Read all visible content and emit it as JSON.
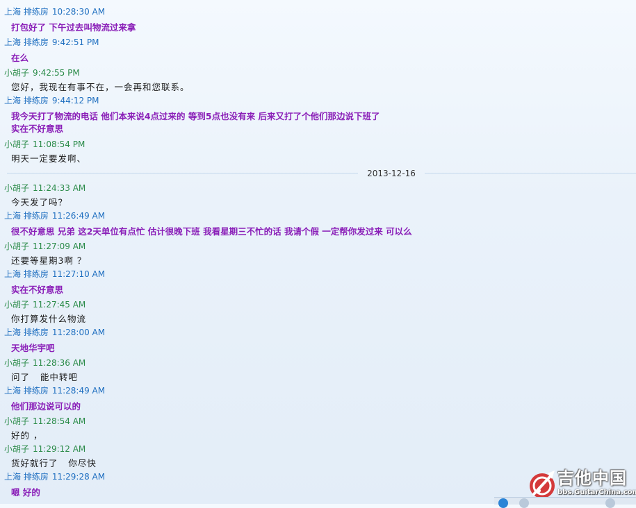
{
  "messages": [
    {
      "sender": "上海 排练房",
      "time": "10:28:30 AM",
      "text": "打包好了 下午过去叫物流过来拿",
      "role": "peer"
    },
    {
      "sender": "上海 排练房",
      "time": "9:42:51 PM",
      "text": "在么",
      "role": "peer"
    },
    {
      "sender": "小胡子",
      "time": "9:42:55 PM",
      "text": "您好，我现在有事不在，一会再和您联系。",
      "role": "self"
    },
    {
      "sender": "上海 排练房",
      "time": "9:44:12 PM",
      "text": "我今天打了物流的电话 他们本来说4点过来的 等到5点也没有来 后来又打了个他们那边说下班了",
      "text2": "实在不好意思",
      "role": "peer"
    },
    {
      "sender": "小胡子",
      "time": "11:08:54 PM",
      "text": "明天一定要发啊、",
      "role": "self"
    },
    {
      "sender": "小胡子",
      "time": "11:24:33 AM",
      "text": "今天发了吗？",
      "role": "self"
    },
    {
      "sender": "上海 排练房",
      "time": "11:26:49 AM",
      "text": "很不好意思 兄弟 这2天单位有点忙 估计很晚下班 我看星期三不忙的话 我请个假 一定帮你发过来 可以么",
      "role": "peer"
    },
    {
      "sender": "小胡子",
      "time": "11:27:09 AM",
      "text": "还要等星期3啊 ？",
      "role": "self"
    },
    {
      "sender": "上海 排练房",
      "time": "11:27:10 AM",
      "text": "实在不好意思",
      "role": "peer"
    },
    {
      "sender": "小胡子",
      "time": "11:27:45 AM",
      "text": "你打算发什么物流",
      "role": "self"
    },
    {
      "sender": "上海 排练房",
      "time": "11:28:00 AM",
      "text": "天地华宇吧",
      "role": "peer"
    },
    {
      "sender": "小胡子",
      "time": "11:28:36 AM",
      "text": "问了   能中转吧",
      "role": "self"
    },
    {
      "sender": "上海 排练房",
      "time": "11:28:49 AM",
      "text": "他们那边说可以的",
      "role": "peer"
    },
    {
      "sender": "小胡子",
      "time": "11:28:54 AM",
      "text": "好的 ，",
      "role": "self"
    },
    {
      "sender": "小胡子",
      "time": "11:29:12 AM",
      "text": "货好就行了   你尽快",
      "role": "self"
    },
    {
      "sender": "上海 排练房",
      "time": "11:29:28 AM",
      "text": "嗯 好的",
      "role": "peer"
    }
  ],
  "date_divider": "2013-12-16",
  "watermark": {
    "title": "吉他中国",
    "url": "bbs.GuitarChina.com"
  },
  "colors": {
    "self_header": "#2b8b49",
    "peer_header": "#1f6fc0",
    "peer_text": "#8a1fb8",
    "self_text": "#1a1a1a"
  },
  "icons": [
    "qq-logo-icon",
    "watermark-guitar-logo-icon"
  ]
}
